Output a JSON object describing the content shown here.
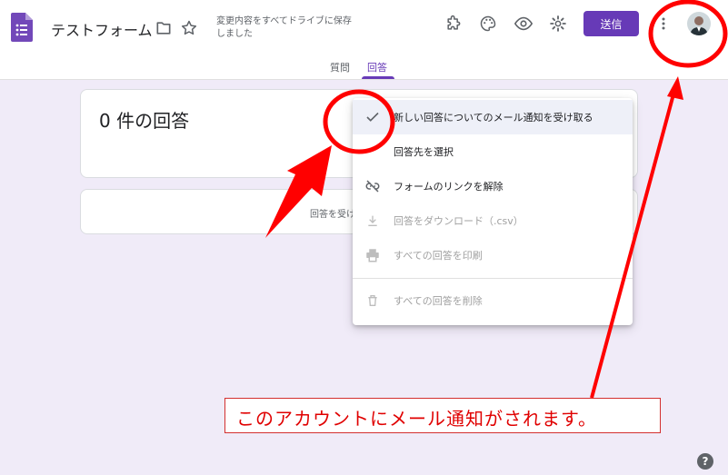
{
  "header": {
    "title": "テストフォーム",
    "save_status": "変更内容をすべてドライブに保存しました",
    "send_label": "送信",
    "icons": [
      "forms-app-icon",
      "folder-icon",
      "star-icon",
      "addon-puzzle-icon",
      "palette-icon",
      "preview-eye-icon",
      "settings-gear-icon",
      "more-vert-icon"
    ]
  },
  "tabs": [
    {
      "label": "質問",
      "active": false
    },
    {
      "label": "回答",
      "active": true
    }
  ],
  "responses": {
    "count_text": "0 件の回答",
    "accepting_text": "回答を受け付"
  },
  "menu": {
    "items": [
      {
        "label": "新しい回答についてのメール通知を受け取る",
        "icon": "check-icon",
        "enabled": true,
        "checked": true
      },
      {
        "label": "回答先を選択",
        "icon": "",
        "enabled": true
      },
      {
        "label": "フォームのリンクを解除",
        "icon": "link-off-icon",
        "enabled": true
      },
      {
        "label": "回答をダウンロード（.csv）",
        "icon": "download-icon",
        "enabled": false
      },
      {
        "label": "すべての回答を印刷",
        "icon": "print-icon",
        "enabled": false
      },
      {
        "label": "すべての回答を削除",
        "icon": "trash-icon",
        "enabled": false
      }
    ]
  },
  "annotation": {
    "text": "このアカウントにメール通知がされます。",
    "color": "#e00000"
  },
  "colors": {
    "accent": "#673ab7",
    "background": "#f0ebf8",
    "annotation_red": "#ff0000"
  }
}
